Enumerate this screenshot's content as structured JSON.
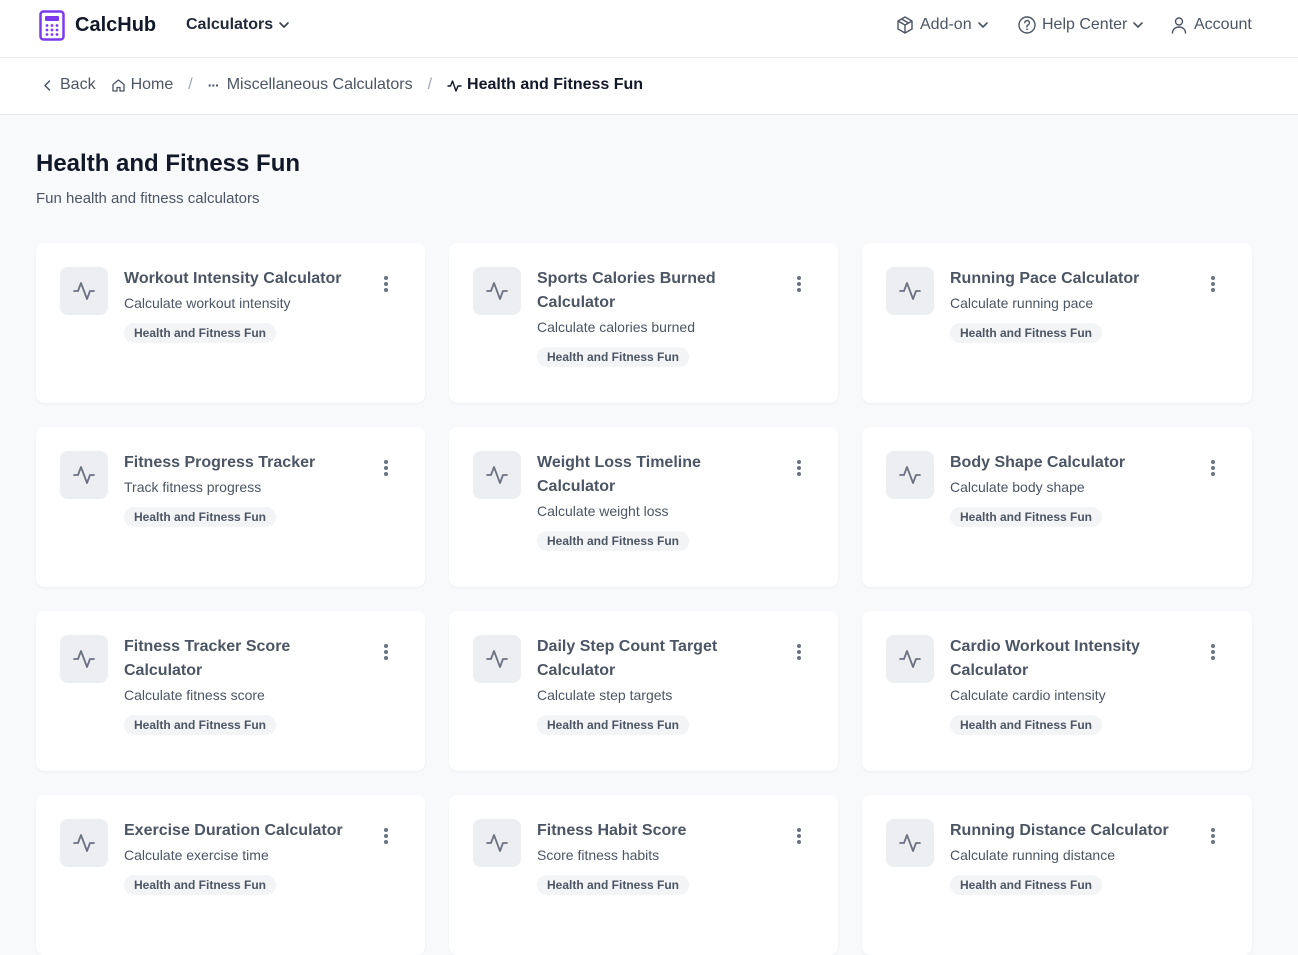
{
  "header": {
    "brand": "CalcHub",
    "calculators_label": "Calculators",
    "addon_label": "Add-on",
    "help_label": "Help Center",
    "account_label": "Account",
    "brand_color": "#7c3aed"
  },
  "breadcrumb": {
    "back": "Back",
    "home": "Home",
    "ellipsis": "···",
    "parent": "Miscellaneous Calculators",
    "current": "Health and Fitness Fun"
  },
  "page": {
    "title": "Health and Fitness Fun",
    "subtitle": "Fun health and fitness calculators"
  },
  "cards": [
    {
      "title": "Workout Intensity Calculator",
      "desc": "Calculate workout intensity",
      "tag": "Health and Fitness Fun"
    },
    {
      "title": "Sports Calories Burned Calculator",
      "desc": "Calculate calories burned",
      "tag": "Health and Fitness Fun"
    },
    {
      "title": "Running Pace Calculator",
      "desc": "Calculate running pace",
      "tag": "Health and Fitness Fun"
    },
    {
      "title": "Fitness Progress Tracker",
      "desc": "Track fitness progress",
      "tag": "Health and Fitness Fun"
    },
    {
      "title": "Weight Loss Timeline Calculator",
      "desc": "Calculate weight loss",
      "tag": "Health and Fitness Fun"
    },
    {
      "title": "Body Shape Calculator",
      "desc": "Calculate body shape",
      "tag": "Health and Fitness Fun"
    },
    {
      "title": "Fitness Tracker Score Calculator",
      "desc": "Calculate fitness score",
      "tag": "Health and Fitness Fun"
    },
    {
      "title": "Daily Step Count Target Calculator",
      "desc": "Calculate step targets",
      "tag": "Health and Fitness Fun"
    },
    {
      "title": "Cardio Workout Intensity Calculator",
      "desc": "Calculate cardio intensity",
      "tag": "Health and Fitness Fun"
    },
    {
      "title": "Exercise Duration Calculator",
      "desc": "Calculate exercise time",
      "tag": "Health and Fitness Fun"
    },
    {
      "title": "Fitness Habit Score",
      "desc": "Score fitness habits",
      "tag": "Health and Fitness Fun"
    },
    {
      "title": "Running Distance Calculator",
      "desc": "Calculate running distance",
      "tag": "Health and Fitness Fun"
    }
  ]
}
